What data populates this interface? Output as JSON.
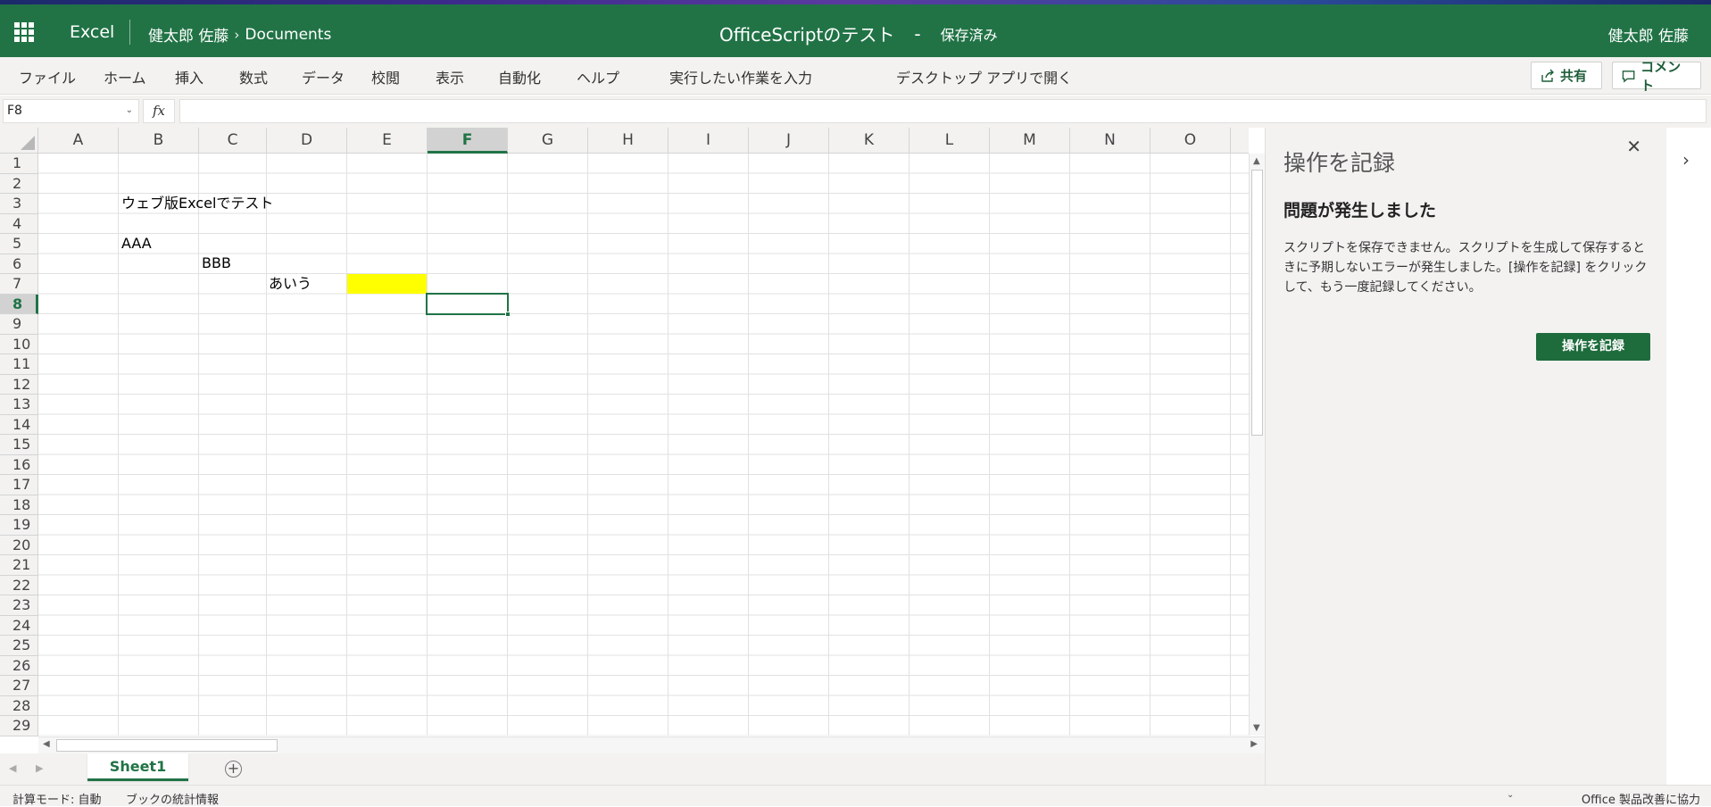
{
  "titlebar": {
    "app_name": "Excel",
    "breadcrumb_owner": "健太郎 佐藤",
    "breadcrumb_sep": "›",
    "breadcrumb_folder": "Documents",
    "doc_title": "OfficeScriptのテスト",
    "title_dash": "-",
    "save_status": "保存済み",
    "user_name": "健太郎 佐藤"
  },
  "ribbon": {
    "tabs": [
      "ファイル",
      "ホーム",
      "挿入",
      "数式",
      "データ",
      "校閲",
      "表示",
      "自動化",
      "ヘルプ"
    ],
    "tell_me": "実行したい作業を入力",
    "open_desktop": "デスクトップ アプリで開く",
    "share_label": "共有",
    "comment_label": "コメント"
  },
  "formula_bar": {
    "name_box": "F8",
    "fx_label": "fx",
    "formula": ""
  },
  "grid": {
    "columns": [
      "A",
      "B",
      "C",
      "D",
      "E",
      "F",
      "G",
      "H",
      "I",
      "J",
      "K",
      "L",
      "M",
      "N",
      "O"
    ],
    "rows": [
      "1",
      "2",
      "3",
      "4",
      "5",
      "6",
      "7",
      "8",
      "9",
      "10",
      "11",
      "12",
      "13",
      "14",
      "15",
      "16",
      "17",
      "18",
      "19",
      "20",
      "21",
      "22",
      "23",
      "24",
      "25",
      "26",
      "27",
      "28",
      "29"
    ],
    "selected_column": "F",
    "selected_row": "8",
    "cells": {
      "B2": "ウェブ版Excelでテスト",
      "B4": "AAA",
      "C5": "BBB",
      "D6": "あいう"
    },
    "fill_color_E7": "#ffff00",
    "accent_color": "#217346"
  },
  "sheets": {
    "active": "Sheet1"
  },
  "status": {
    "calc_mode": "計算モード: 自動",
    "workbook_stats": "ブックの統計情報",
    "feedback": "Office 製品改善に協力"
  },
  "pane": {
    "title": "操作を記録",
    "error_title": "問題が発生しました",
    "message": "スクリプトを保存できません。スクリプトを生成して保存するときに予期しないエラーが発生しました。[操作を記録] をクリックして、もう一度記録してください。",
    "button": "操作を記録"
  }
}
